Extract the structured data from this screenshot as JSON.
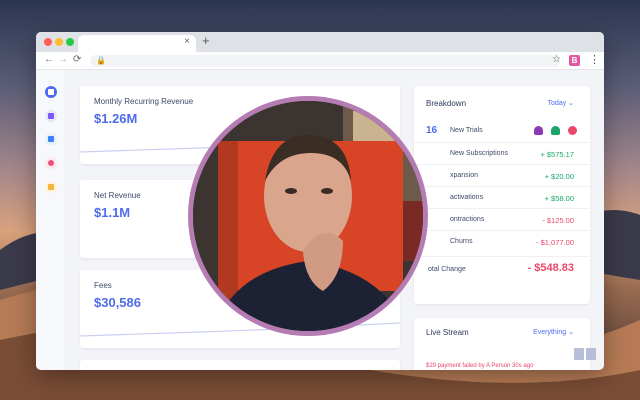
{
  "browser": {
    "tab_close": "×",
    "new_tab": "+",
    "nav_back": "←",
    "nav_forward": "→",
    "nav_reload": "⟳",
    "lock_icon": "lock-icon",
    "star_icon": "☆",
    "extension_badge": "B",
    "menu_icon": "⋮"
  },
  "sidebar": {
    "items": [
      {
        "name": "dashboard",
        "color": "#4f6bed"
      },
      {
        "name": "customers",
        "color": "#7a5af8"
      },
      {
        "name": "reports",
        "color": "#3b82f6"
      },
      {
        "name": "alerts",
        "color": "#ef4f7a"
      },
      {
        "name": "insights",
        "color": "#f3b63a"
      }
    ]
  },
  "metrics": [
    {
      "label": "Monthly Recurring Revenue",
      "value": "$1.26M"
    },
    {
      "label": "Net Revenue",
      "value": "$1.1M"
    },
    {
      "label": "Fees",
      "value": "$30,586"
    }
  ],
  "breakdown": {
    "title": "Breakdown",
    "filter": "Today",
    "trials_count": "16",
    "rows": [
      {
        "label": "New Trials",
        "value": ""
      },
      {
        "label": "New Subscriptions",
        "value": "+ $575.17",
        "tone": "pos"
      },
      {
        "label": "xpansion",
        "value": "+ $20.00",
        "tone": "pos"
      },
      {
        "label": "activations",
        "value": "+ $58.00",
        "tone": "pos"
      },
      {
        "label": "ontractions",
        "value": "- $125.00",
        "tone": "neg"
      },
      {
        "label": "Churns",
        "value": "- $1,077.00",
        "tone": "neg"
      }
    ],
    "total_label": "otal Change",
    "total_value": "- $548.83"
  },
  "live_stream": {
    "title": "Live Stream",
    "filter": "Everything",
    "event": "$29 payment failed by A Person        30s ago"
  },
  "colors": {
    "accent": "#4f6bed",
    "positive": "#1aa566",
    "negative": "#e8476a",
    "webcam_border": "#b57bb3"
  }
}
